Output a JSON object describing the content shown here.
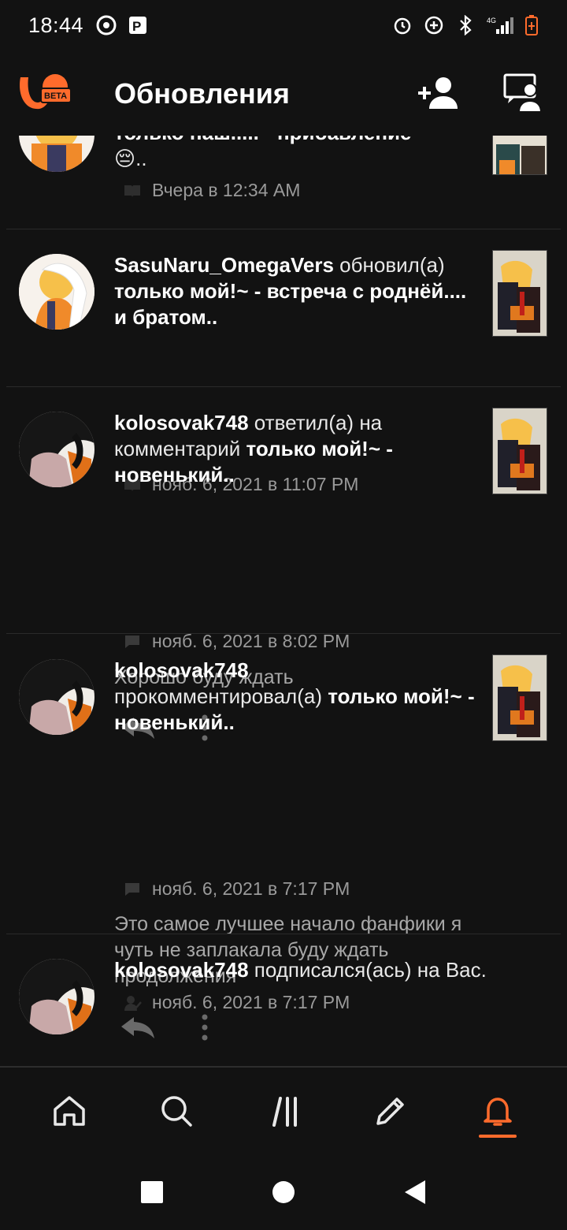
{
  "status": {
    "time": "18:44",
    "network": "4G"
  },
  "header": {
    "logo_badge": "BETA",
    "title": "Обновления"
  },
  "feed": [
    {
      "user": "",
      "text_line1": "только наш.....  - прибавление",
      "text_line2": "😔..",
      "time": "Вчера в 12:34 AM"
    },
    {
      "user": "SasuNaru_OmegaVers",
      "action": "обновил(а)",
      "work": "только мой!~ - встреча с роднёй.... и братом..",
      "time": "нояб. 6, 2021 в 11:07 PM"
    },
    {
      "user": "kolosovak748",
      "action": "ответил(а) на комментарий",
      "work": "только мой!~ - новенький..",
      "time": "нояб. 6, 2021 в 8:02 PM",
      "comment": "Хорошо буду ждать"
    },
    {
      "user": "kolosovak748",
      "action": "прокомментировал(а)",
      "work": "только мой!~ - новенький..",
      "time": "нояб. 6, 2021 в 7:17 PM",
      "comment": "Это самое лучшее начало фанфики я чуть не заплакала буду ждать продолжения"
    },
    {
      "user": "kolosovak748",
      "action": "подписался(ась) на Вас.",
      "time": "нояб. 6, 2021 в 7:17 PM"
    }
  ],
  "colors": {
    "accent": "#ff6b2c",
    "background": "#121212",
    "muted": "#9a9a9a"
  }
}
